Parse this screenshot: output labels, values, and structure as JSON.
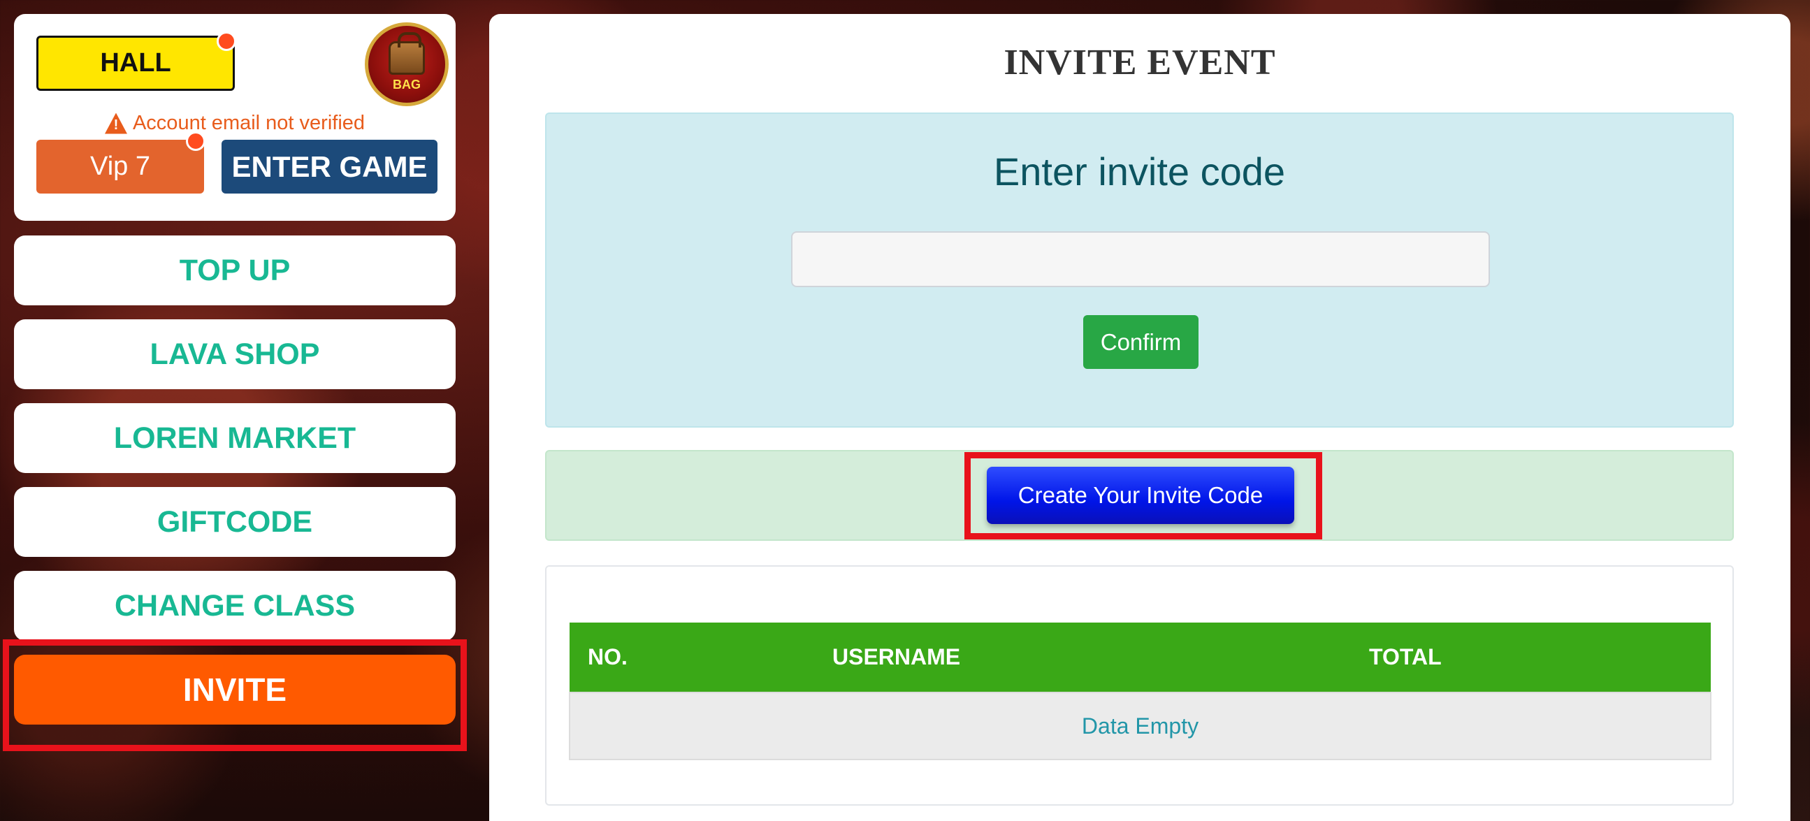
{
  "sidebar": {
    "hall_label": "HALL",
    "bag_label": "BAG",
    "email_warning": "Account email not verified",
    "vip_label": "Vip 7",
    "enter_game_label": "ENTER GAME",
    "menu": {
      "top_up": "TOP UP",
      "lava_shop": "LAVA SHOP",
      "loren_market": "LOREN MARKET",
      "giftcode": "GIFTCODE",
      "change_class": "CHANGE CLASS",
      "invite": "INVITE"
    },
    "active_item": "INVITE"
  },
  "main": {
    "title": "INVITE EVENT",
    "invite_box": {
      "heading": "Enter invite code",
      "input_value": "",
      "confirm_label": "Confirm"
    },
    "create_button_label": "Create Your Invite Code",
    "table": {
      "headers": [
        "NO.",
        "USERNAME",
        "TOTAL"
      ],
      "empty_text": "Data Empty"
    }
  },
  "icons": {
    "bag": "bag-icon",
    "warning": "warning-icon"
  },
  "colors": {
    "hall_yellow": "#ffe600",
    "vip_orange": "#e3642d",
    "enter_game_blue": "#1c4a7a",
    "menu_text_teal": "#18b893",
    "invite_active_orange": "#ff5a00",
    "highlight_red": "#e8121b",
    "confirm_green": "#28a745",
    "create_blue": "#0015e8",
    "table_header_green": "#3aa817"
  }
}
